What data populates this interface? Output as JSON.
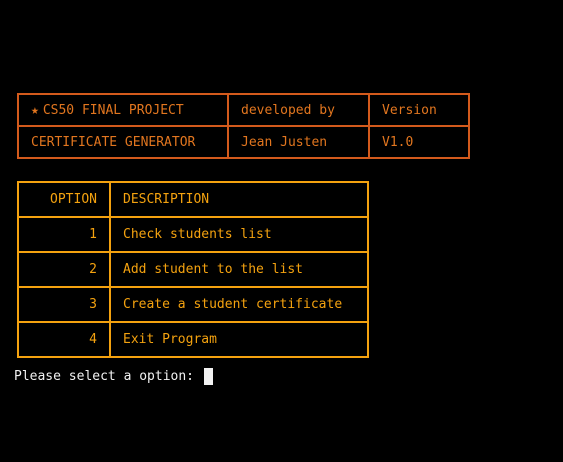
{
  "header": {
    "project_title": "CS50 FINAL PROJECT",
    "developed_by_label": "developed by",
    "version_label": "Version",
    "app_name": "CERTIFICATE GENERATOR",
    "developer": "Jean Justen",
    "version": "V1.0",
    "star_icon": "★"
  },
  "menu": {
    "col_option": "OPTION",
    "col_description": "DESCRIPTION",
    "rows": [
      {
        "option": "1",
        "description": "Check students list"
      },
      {
        "option": "2",
        "description": "Add student to the list"
      },
      {
        "option": "3",
        "description": "Create a student certificate"
      },
      {
        "option": "4",
        "description": "Exit Program"
      }
    ]
  },
  "prompt": {
    "text": "Please select a option: "
  },
  "colors": {
    "background": "#000000",
    "header_border": "#d35a1c",
    "header_text": "#e2761f",
    "menu_border": "#f4a20f",
    "menu_text": "#f4a20f",
    "prompt_text": "#f2f2f2"
  }
}
